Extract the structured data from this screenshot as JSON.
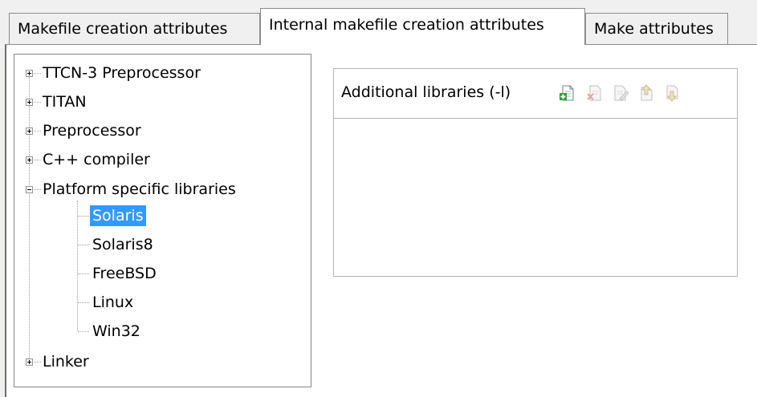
{
  "tabs": [
    {
      "label": "Makefile creation attributes",
      "active": false
    },
    {
      "label": "Internal makefile creation attributes",
      "active": true
    },
    {
      "label": "Make attributes",
      "active": false
    }
  ],
  "tree": {
    "items": [
      {
        "label": "TTCN-3 Preprocessor",
        "expander": "plus"
      },
      {
        "label": "TITAN",
        "expander": "plus"
      },
      {
        "label": "Preprocessor",
        "expander": "plus"
      },
      {
        "label": "C++ compiler",
        "expander": "plus"
      },
      {
        "label": "Platform specific libraries",
        "expander": "minus",
        "children": [
          "Solaris",
          "Solaris8",
          "FreeBSD",
          "Linux",
          "Win32"
        ],
        "selected_child": "Solaris"
      },
      {
        "label": "Linker",
        "expander": "plus"
      }
    ]
  },
  "libraries": {
    "title": "Additional libraries (-l)",
    "toolbar_icons": [
      "add-item-icon",
      "delete-item-icon",
      "edit-item-icon",
      "move-up-icon",
      "move-down-icon"
    ],
    "items": []
  },
  "colors": {
    "selection": "#3399ff",
    "add_icon_accent": "#2e9b2e"
  }
}
